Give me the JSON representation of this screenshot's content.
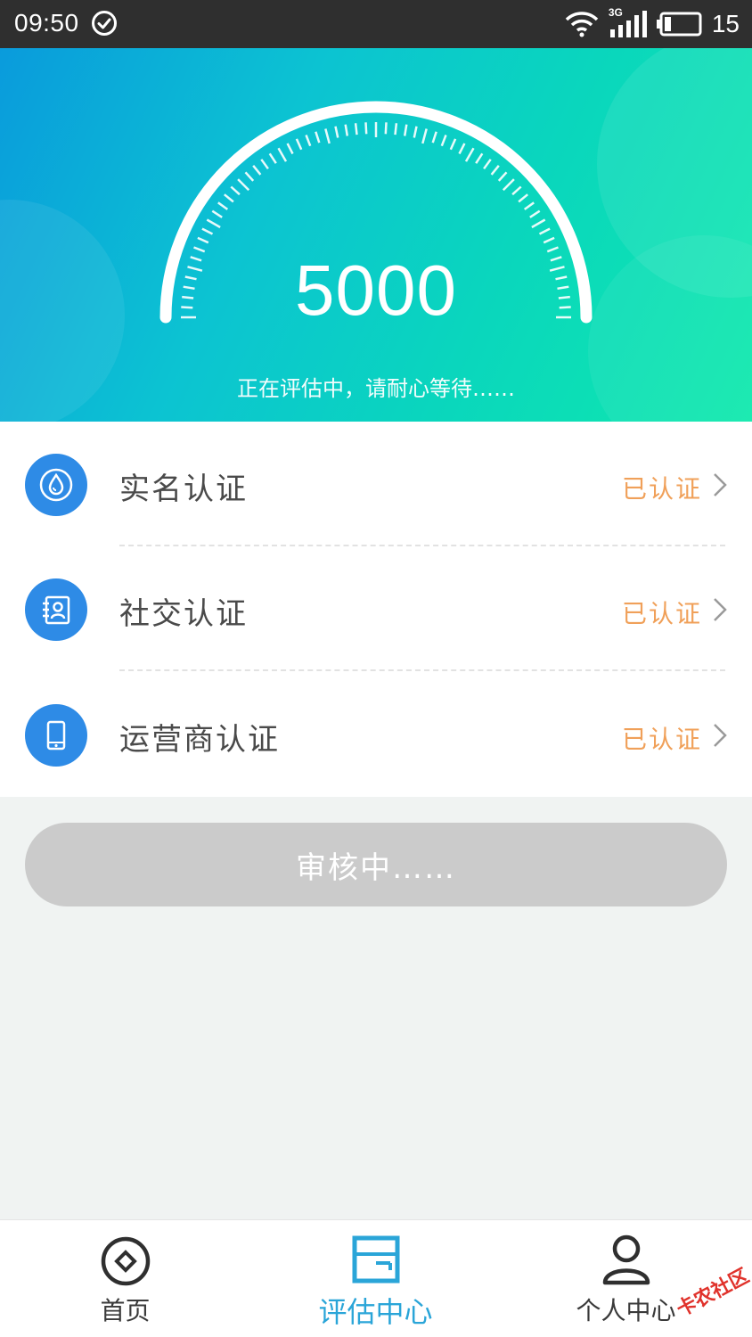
{
  "status_bar": {
    "time": "09:50",
    "network": "3G",
    "battery": "15"
  },
  "hero": {
    "score": "5000",
    "hint": "正在评估中，请耐心等待……"
  },
  "verifications": [
    {
      "label": "实名认证",
      "status": "已认证",
      "icon": "drop-icon"
    },
    {
      "label": "社交认证",
      "status": "已认证",
      "icon": "contact-book-icon"
    },
    {
      "label": "运营商认证",
      "status": "已认证",
      "icon": "phone-icon"
    }
  ],
  "review_button": {
    "label": "审核中……"
  },
  "bottom_nav": [
    {
      "label": "首页",
      "icon": "home-compass-icon",
      "active": false
    },
    {
      "label": "评估中心",
      "icon": "assessment-icon",
      "active": true
    },
    {
      "label": "个人中心",
      "icon": "user-icon",
      "active": false
    }
  ],
  "watermark": "卡农社区",
  "colors": {
    "accent": "#2aa5d8",
    "status_verified": "#f0a059",
    "icon_bg": "#2e8be6",
    "button_disabled": "#cbcbcb"
  }
}
